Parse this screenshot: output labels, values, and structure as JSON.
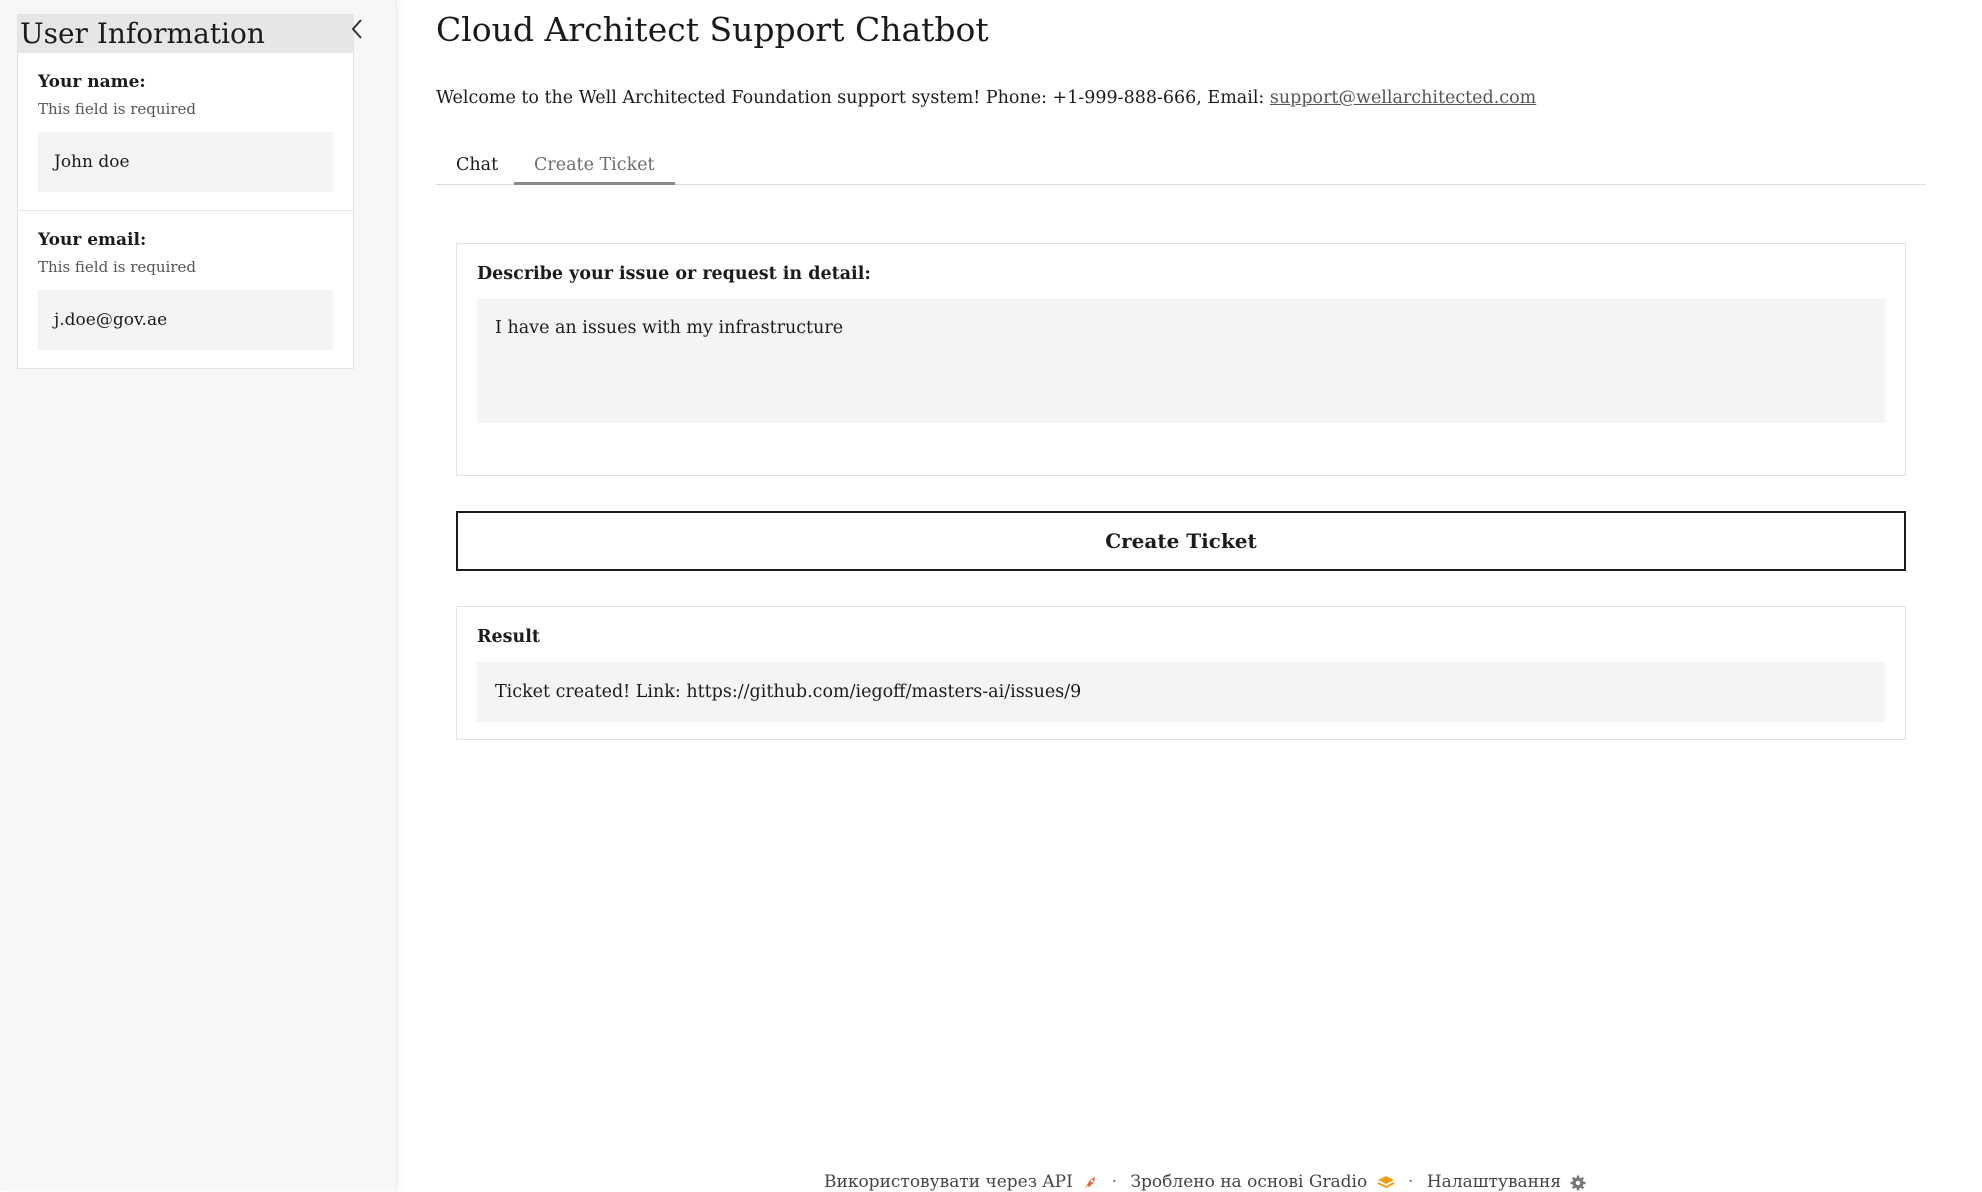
{
  "sidebar": {
    "title": "User Information",
    "fields": [
      {
        "label": "Your name:",
        "hint": "This field is required",
        "value": "John doe"
      },
      {
        "label": "Your email:",
        "hint": "This field is required",
        "value": "j.doe@gov.ae"
      }
    ]
  },
  "header": {
    "title": "Cloud Architect Support Chatbot",
    "welcome_text": "Welcome to the Well Architected Foundation support system! Phone: +1-999-888-666, Email: ",
    "email_link": "support@wellarchitected.com"
  },
  "tabs": [
    {
      "label": "Chat",
      "active": false
    },
    {
      "label": "Create Ticket",
      "active": true
    }
  ],
  "issue": {
    "label": "Describe your issue or request in detail:",
    "value": "I have an issues with my infrastructure"
  },
  "create_button_label": "Create Ticket",
  "result": {
    "label": "Result",
    "value": "Ticket created! Link: https://github.com/iegoff/masters-ai/issues/9"
  },
  "footer": {
    "api_label": "Використовувати через API",
    "gradio_label": "Зроблено на основі Gradio",
    "settings_label": "Налаштування",
    "separator": "·"
  },
  "icons": {
    "collapse": "chevron-left-icon",
    "api": "rocket-icon",
    "gradio": "gradio-logo-icon",
    "settings": "gear-icon"
  },
  "colors": {
    "sidebar_bg": "#f7f7f7",
    "input_bg": "#f4f4f4",
    "button_border": "#1a1a1a",
    "gradio_orange": "#f39c12"
  }
}
